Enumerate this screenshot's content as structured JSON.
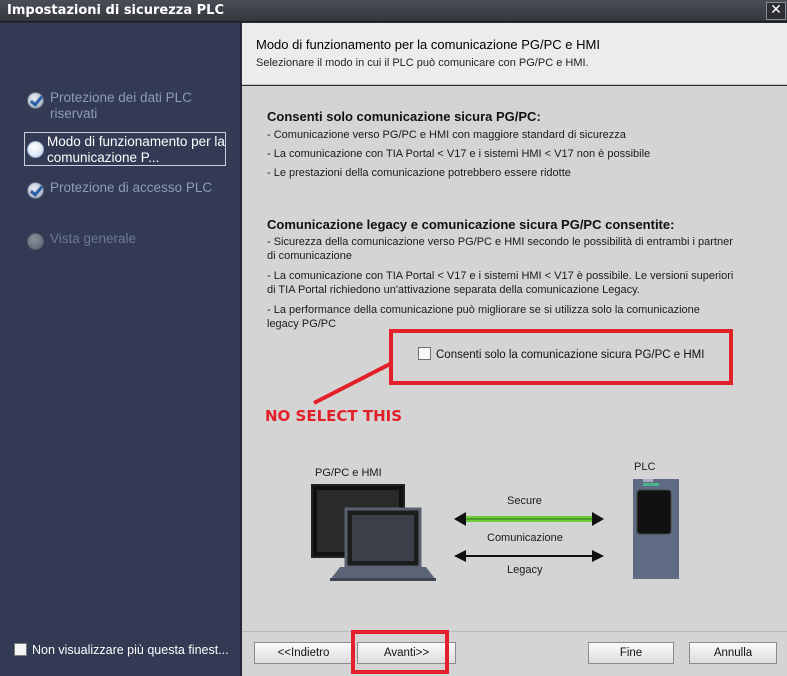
{
  "window": {
    "title": "Impostazioni di sicurezza PLC",
    "close_glyph": "✕"
  },
  "sidebar": {
    "items": [
      {
        "label": "Protezione dei dati PLC riservati",
        "state": "done",
        "icon": "checkmark-icon"
      },
      {
        "label": "Modo di funzionamento per la comunicazione P...",
        "state": "current",
        "icon": "active-step-icon"
      },
      {
        "label": "Protezione di accesso PLC",
        "state": "done",
        "icon": "checkmark-icon"
      },
      {
        "label": "Vista generale",
        "state": "pending",
        "icon": "pending-step-icon"
      }
    ],
    "dont_show_label": "Non visualizzare più questa finest..."
  },
  "header": {
    "title": "Modo di funzionamento per la comunicazione PG/PC e HMI",
    "subtitle": "Selezionare il modo in cui il PLC può comunicare con PG/PC e HMI."
  },
  "content": {
    "section1": {
      "heading": "Consenti solo comunicazione sicura PG/PC:",
      "lines": [
        "- Comunicazione verso PG/PC e HMI con maggiore standard di sicurezza",
        "- La comunicazione con TIA Portal < V17 e i sistemi HMI < V17 non è possibile",
        "- Le prestazioni della comunicazione potrebbero essere ridotte"
      ]
    },
    "section2": {
      "heading": "Comunicazione legacy e comunicazione sicura PG/PC consentite:",
      "lines": [
        "- Sicurezza della comunicazione verso PG/PC e HMI secondo le possibilità di entrambi i partner",
        "di comunicazione",
        "- La comunicazione con TIA Portal < V17 e i sistemi HMI < V17 è possibile. Le versioni superiori",
        "di TIA Portal richiedono un'attivazione separata della comunicazione Legacy.",
        "- La performance della comunicazione può migliorare se si utilizza solo la comunicazione",
        "legacy PG/PC"
      ]
    },
    "checkbox_label": "Consenti solo la comunicazione sicura PG/PC e HMI",
    "checkbox_checked": false,
    "annotation": "NO SELECT THIS",
    "annotation_color": "#e3202a"
  },
  "diagram": {
    "left_label": "PG/PC e HMI",
    "right_label": "PLC",
    "secure_label": "Secure",
    "comm_label": "Comunicazione",
    "legacy_label": "Legacy",
    "secure_color": "#6fcf3a"
  },
  "footer": {
    "back_label": "<<Indietro",
    "next_label": "Avanti>>",
    "finish_label": "Fine",
    "cancel_label": "Annulla"
  }
}
